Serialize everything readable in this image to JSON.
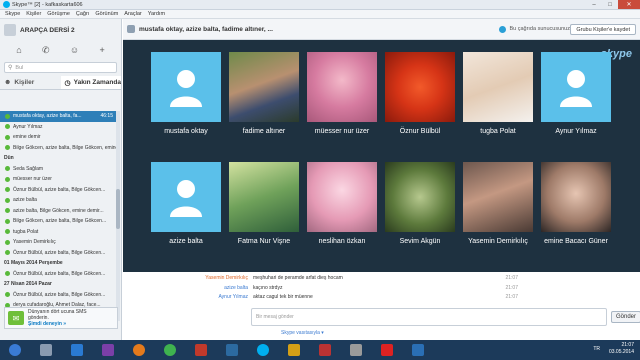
{
  "window": {
    "title": "Skype™ [2] - kafkaskarta606",
    "min": "–",
    "max": "□",
    "close": "✕"
  },
  "menu": [
    "Skype",
    "Kişiler",
    "Görüşme",
    "Çağrı",
    "Görünüm",
    "Araçlar",
    "Yardım"
  ],
  "sidebar": {
    "profile_name": "ARAPÇA DERSİ 2",
    "search_placeholder": "Bul",
    "tabs": [
      {
        "label": "Kişiler"
      },
      {
        "label": "Yakın Zamanda"
      }
    ],
    "conversations": [
      {
        "label": "mustafa oktay, azize balta, fa...",
        "time": "46:15",
        "active": true
      },
      {
        "label": "Aynur Yılmaz"
      },
      {
        "label": "emine demir"
      },
      {
        "label": "Bilge Gökcen, azize balta, Bilge Gökcen, emine demir..."
      },
      {
        "label": "Dün",
        "header": true
      },
      {
        "label": "Seda Sağlam"
      },
      {
        "label": "müesser nur üzer"
      },
      {
        "label": "Öznur Bülbül, azize balta, Bilge Gökcen..."
      },
      {
        "label": "azize balta"
      },
      {
        "label": "azize balta, Bilge Gökcen, emine demir..."
      },
      {
        "label": "Bilge Gökcen, azize balta, Bilge Gökcen..."
      },
      {
        "label": "tugba Polat"
      },
      {
        "label": "Yasemin Demirkılıç"
      },
      {
        "label": "Öznur Bülbül, azize balta, Bilge Gökcen..."
      },
      {
        "label": "01 Mayıs 2014 Perşembe",
        "header": true
      },
      {
        "label": "Öznur Bülbül, azize balta, Bilge Gökcen..."
      },
      {
        "label": "27 Nisan 2014 Pazar",
        "header": true
      },
      {
        "label": "Öznur Bülbül, azize balta, Bilge Gökcen..."
      },
      {
        "label": "derya cufadaroğlu, Ahmet Dalaz, face..."
      }
    ],
    "sms": {
      "line1": "Dünyanın dört ucuna SMS",
      "line2": "gönderin.",
      "link": "Şimdi deneyin »"
    }
  },
  "header": {
    "title": "mustafa oktay, azize balta, fadime altıner, ...",
    "call_text": "Bu çağrıda sunucusunuz",
    "save_button": "Grubu Kişiler'e kaydet"
  },
  "stage": {
    "logo": "skype",
    "participants": [
      {
        "name": "mustafa oktay",
        "photo": "default-avatar"
      },
      {
        "name": "fadime altıner",
        "photo": "boy-outdoors"
      },
      {
        "name": "müesser nur üzer",
        "photo": "pink-flowers"
      },
      {
        "name": "Öznur Bülbül",
        "photo": "red-flower"
      },
      {
        "name": "tugba Polat",
        "photo": "baby"
      },
      {
        "name": "Aynur Yılmaz",
        "photo": "default-avatar"
      },
      {
        "name": "azize balta",
        "photo": "default-avatar"
      },
      {
        "name": "Fatma Nur Vişne",
        "photo": "birds-green"
      },
      {
        "name": "neslihan özkan",
        "photo": "pink-blossom"
      },
      {
        "name": "Sevim Akgün",
        "photo": "green-bird"
      },
      {
        "name": "Yasemin Demirkılıç",
        "photo": "child-face"
      },
      {
        "name": "emine Bacacı Güner",
        "photo": "girl-portrait"
      }
    ]
  },
  "chat": {
    "messages": [
      {
        "who": "Yasemin Demirkılıç",
        "text": "meşhuhari de peramde arfat dieş hocam",
        "time": "21:07",
        "color": "orange"
      },
      {
        "who": "azize balta",
        "text": "kaçıno strdyz",
        "time": "21:07",
        "color": "blue"
      },
      {
        "who": "Aynur Yılmaz",
        "text": "aktaz cagul tek bir müenne",
        "time": "21:07",
        "color": "blue"
      }
    ],
    "composer_placeholder": "Bir mesaj gönder",
    "send_label": "Gönder",
    "via": "Skype vasıtasıyla ▾"
  },
  "taskbar": {
    "lang": "TR",
    "time": "21:07",
    "date": "03.05.2014"
  }
}
